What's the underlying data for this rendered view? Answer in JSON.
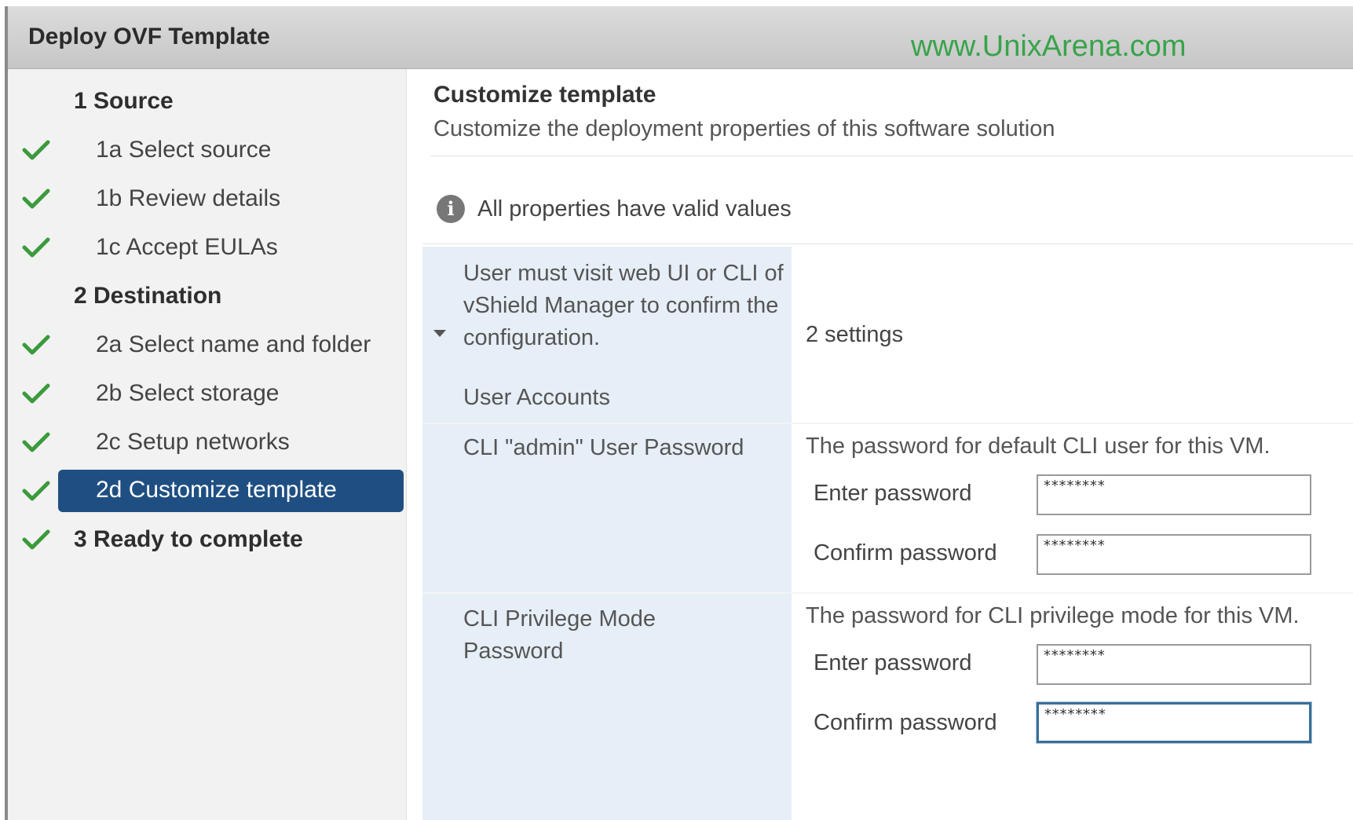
{
  "window": {
    "title": "Deploy OVF Template",
    "watermark": "www.UnixArena.com"
  },
  "sidebar": {
    "steps": [
      {
        "label": "1  Source",
        "level": "major",
        "checked": false,
        "active": false
      },
      {
        "label": "1a  Select source",
        "level": "minor",
        "checked": true,
        "active": false
      },
      {
        "label": "1b  Review details",
        "level": "minor",
        "checked": true,
        "active": false
      },
      {
        "label": "1c  Accept EULAs",
        "level": "minor",
        "checked": true,
        "active": false
      },
      {
        "label": "2  Destination",
        "level": "major",
        "checked": false,
        "active": false
      },
      {
        "label": "2a  Select name and folder",
        "level": "minor",
        "checked": true,
        "active": false
      },
      {
        "label": "2b  Select storage",
        "level": "minor",
        "checked": true,
        "active": false
      },
      {
        "label": "2c  Setup networks",
        "level": "minor",
        "checked": true,
        "active": false
      },
      {
        "label": "2d  Customize template",
        "level": "minor",
        "checked": true,
        "active": true
      },
      {
        "label": "3  Ready to complete",
        "level": "major",
        "checked": true,
        "active": false
      }
    ]
  },
  "content": {
    "heading": "Customize template",
    "subheading": "Customize the deployment properties of this software solution",
    "status": {
      "icon": "info-icon",
      "text": "All properties have valid values"
    },
    "group": {
      "label": "User must visit web UI or CLI of vShield Manager to confirm the configuration.",
      "value": "2 settings",
      "sub_label": "User Accounts"
    },
    "properties": [
      {
        "label": "CLI \"admin\" User Password",
        "description": "The password for default CLI user for this VM.",
        "enter_label": "Enter password",
        "enter_value": "********",
        "confirm_label": "Confirm password",
        "confirm_value": "********"
      },
      {
        "label": "CLI Privilege Mode Password",
        "description": "The password for CLI privilege mode for this VM.",
        "enter_label": "Enter password",
        "enter_value": "********",
        "confirm_label": "Confirm password",
        "confirm_value": "********"
      }
    ]
  },
  "colors": {
    "active_step": "#1f4f82",
    "check": "#3b9a3b",
    "watermark": "#38a34a",
    "label_column": "#e6eef7"
  }
}
